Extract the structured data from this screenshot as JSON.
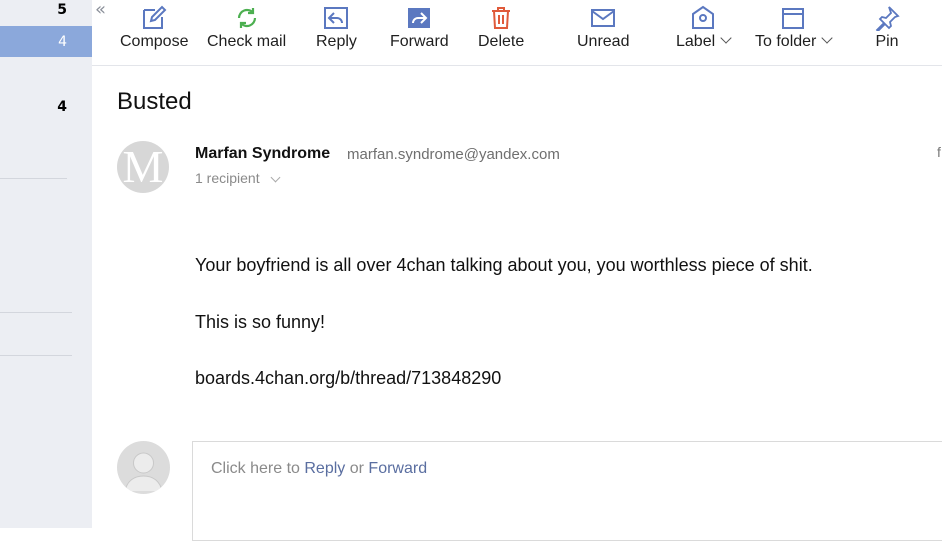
{
  "sidebar": {
    "counts": [
      "5",
      "4",
      "4"
    ]
  },
  "toolbar": {
    "collapse_icon": "«",
    "buttons": [
      {
        "label": "Compose",
        "icon": "compose-icon",
        "color": "#5b78c0"
      },
      {
        "label": "Check mail",
        "icon": "refresh-icon",
        "color": "#4caf50"
      },
      {
        "label": "Reply",
        "icon": "reply-icon",
        "color": "#5b78c0"
      },
      {
        "label": "Forward",
        "icon": "forward-icon",
        "color": "#5b78c0"
      },
      {
        "label": "Delete",
        "icon": "trash-icon",
        "color": "#e05a3a"
      },
      {
        "label": "Unread",
        "icon": "envelope-icon",
        "color": "#5b78c0"
      },
      {
        "label": "Label",
        "icon": "tag-icon",
        "color": "#5b78c0"
      },
      {
        "label": "To folder",
        "icon": "folder-icon",
        "color": "#5b78c0"
      },
      {
        "label": "Pin",
        "icon": "pin-icon",
        "color": "#5b78c0"
      }
    ]
  },
  "message": {
    "subject": "Busted",
    "sender_initial": "M",
    "sender_name": "Marfan Syndrome",
    "sender_email": "marfan.syndrome@yandex.com",
    "recipients": "1 recipient",
    "edge_glyph": "f",
    "body": [
      "Your boyfriend is all over 4chan talking about you, you worthless piece of shit.",
      "This is so funny!",
      "boards.4chan.org/b/thread/713848290"
    ]
  },
  "reply": {
    "prefix": "Click here to",
    "reply_link": "Reply",
    "or": "or",
    "forward_link": "Forward"
  }
}
